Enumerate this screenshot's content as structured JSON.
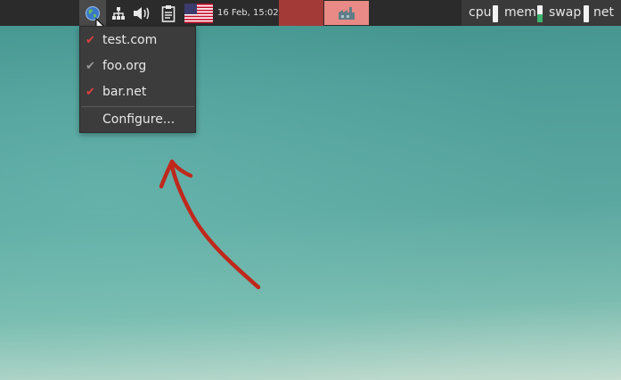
{
  "panel": {
    "clock": "16 Feb, 15:02",
    "tray_icons": [
      "globe-icon",
      "network-icon",
      "volume-icon",
      "clipboard-icon",
      "flag-us-icon"
    ],
    "task_icon": "factory-icon"
  },
  "monitors": [
    {
      "label": "cpu",
      "level": 0.0,
      "color": "#f2f2f2"
    },
    {
      "label": "mem",
      "level": 0.45,
      "color": "#3cb46e"
    },
    {
      "label": "swap",
      "level": 0.0,
      "color": "#f2f2f2"
    },
    {
      "label": "net",
      "level": 0.0,
      "color": "#f2f2f2"
    }
  ],
  "menu": {
    "items": [
      {
        "label": "test.com",
        "checked": true,
        "check_color": "#e04040"
      },
      {
        "label": "foo.org",
        "checked": true,
        "check_color": "#9a9a9a"
      },
      {
        "label": "bar.net",
        "checked": true,
        "check_color": "#e04040"
      }
    ],
    "configure_label": "Configure..."
  },
  "annotation": {
    "color": "#c0281c",
    "shape": "hand-drawn-arrow-pointing-up"
  }
}
